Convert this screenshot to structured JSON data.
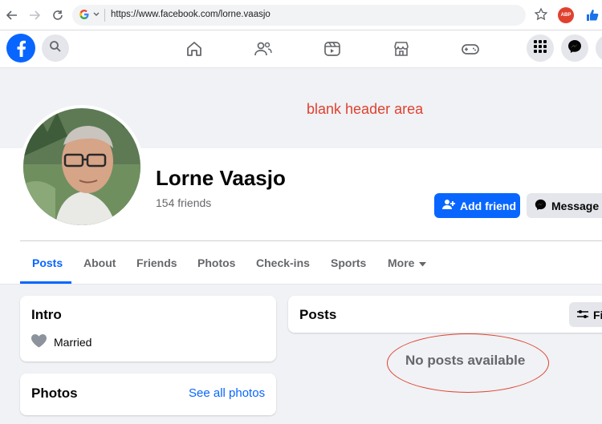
{
  "browser": {
    "url": "https://www.facebook.com/lorne.vaasjo",
    "abp_label": "ABP"
  },
  "annotations": {
    "header_note": "blank header area"
  },
  "profile": {
    "name": "Lorne Vaasjo",
    "friends": "154 friends",
    "add_friend_label": "Add friend",
    "message_label": "Message"
  },
  "tabs": [
    {
      "label": "Posts",
      "active": true
    },
    {
      "label": "About"
    },
    {
      "label": "Friends"
    },
    {
      "label": "Photos"
    },
    {
      "label": "Check-ins"
    },
    {
      "label": "Sports"
    },
    {
      "label": "More"
    }
  ],
  "intro": {
    "title": "Intro",
    "relationship": "Married"
  },
  "photos": {
    "title": "Photos",
    "see_all": "See all photos"
  },
  "posts": {
    "title": "Posts",
    "filter_label": "Fi",
    "empty_text": "No posts available"
  },
  "colors": {
    "brand_blue": "#0866ff",
    "annotation_red": "#e0412f"
  }
}
